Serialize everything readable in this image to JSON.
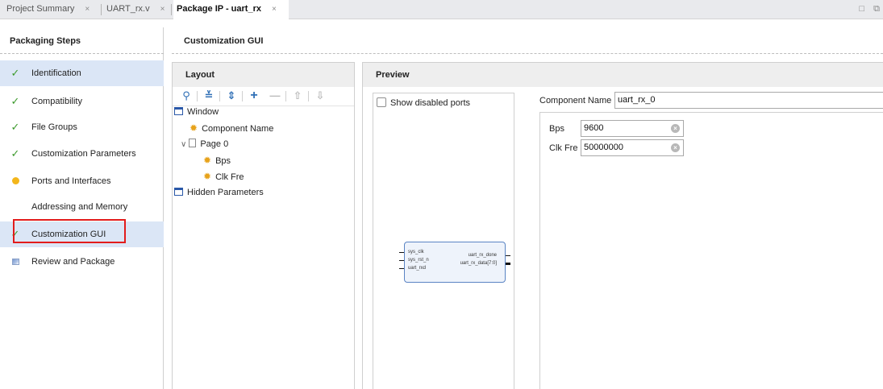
{
  "tabs": [
    {
      "label": "Project Summary",
      "close": "×",
      "active": false
    },
    {
      "label": "UART_rx.v",
      "close": "×",
      "active": false
    },
    {
      "label": "Package IP - uart_rx",
      "close": "×",
      "active": true
    }
  ],
  "window_controls": {
    "restore": "□",
    "float": "⧉"
  },
  "steps_panel": {
    "title": "Packaging Steps",
    "items": [
      {
        "label": "Identification",
        "status": "complete",
        "icon": "check-icon"
      },
      {
        "label": "Compatibility",
        "status": "complete",
        "icon": "check-icon"
      },
      {
        "label": "File Groups",
        "status": "complete",
        "icon": "check-icon"
      },
      {
        "label": "Customization Parameters",
        "status": "complete",
        "icon": "check-icon"
      },
      {
        "label": "Ports and Interfaces",
        "status": "warning",
        "icon": "warning-dot-icon"
      },
      {
        "label": "Addressing and Memory",
        "status": "none",
        "icon": ""
      },
      {
        "label": "Customization GUI",
        "status": "complete",
        "icon": "check-icon"
      },
      {
        "label": "Review and Package",
        "status": "pending",
        "icon": "review-icon"
      }
    ],
    "check_glyph": "✓"
  },
  "gui_panel": {
    "title": "Customization GUI",
    "layout": {
      "title": "Layout",
      "toolbar_icons": [
        "search-icon",
        "collapse-all-icon",
        "expand-all-icon",
        "add-icon",
        "remove-icon",
        "move-up-icon",
        "move-down-icon"
      ],
      "toolbar_glyphs": {
        "search": "⚲",
        "collapse": "≚",
        "expand": "⇕",
        "add": "+",
        "remove": "—",
        "up": "⇧",
        "down": "⇩"
      },
      "tree": {
        "window": "Window",
        "component_name": "Component Name",
        "page": "Page 0",
        "bps": "Bps",
        "clk_fre": "Clk Fre",
        "hidden": "Hidden Parameters"
      }
    },
    "preview": {
      "title": "Preview",
      "show_disabled_ports": "Show disabled ports",
      "show_disabled_checked": false,
      "ip_symbol": {
        "inputs": [
          "sys_clk",
          "sys_rst_n",
          "uart_rxd"
        ],
        "outputs": [
          "uart_rx_done",
          "uart_rx_data[7:0]"
        ]
      },
      "component_name_label": "Component Name",
      "component_name_value": "uart_rx_0",
      "params": [
        {
          "label": "Bps",
          "value": "9600"
        },
        {
          "label": "Clk Fre",
          "value": "50000000"
        }
      ],
      "clear_glyph": "×"
    }
  },
  "colors": {
    "selected_row": "#dbe6f6",
    "check": "#3c9a2c",
    "warning": "#f3b61b",
    "highlight": "#e21c1c",
    "gear": "#e7a21a"
  }
}
